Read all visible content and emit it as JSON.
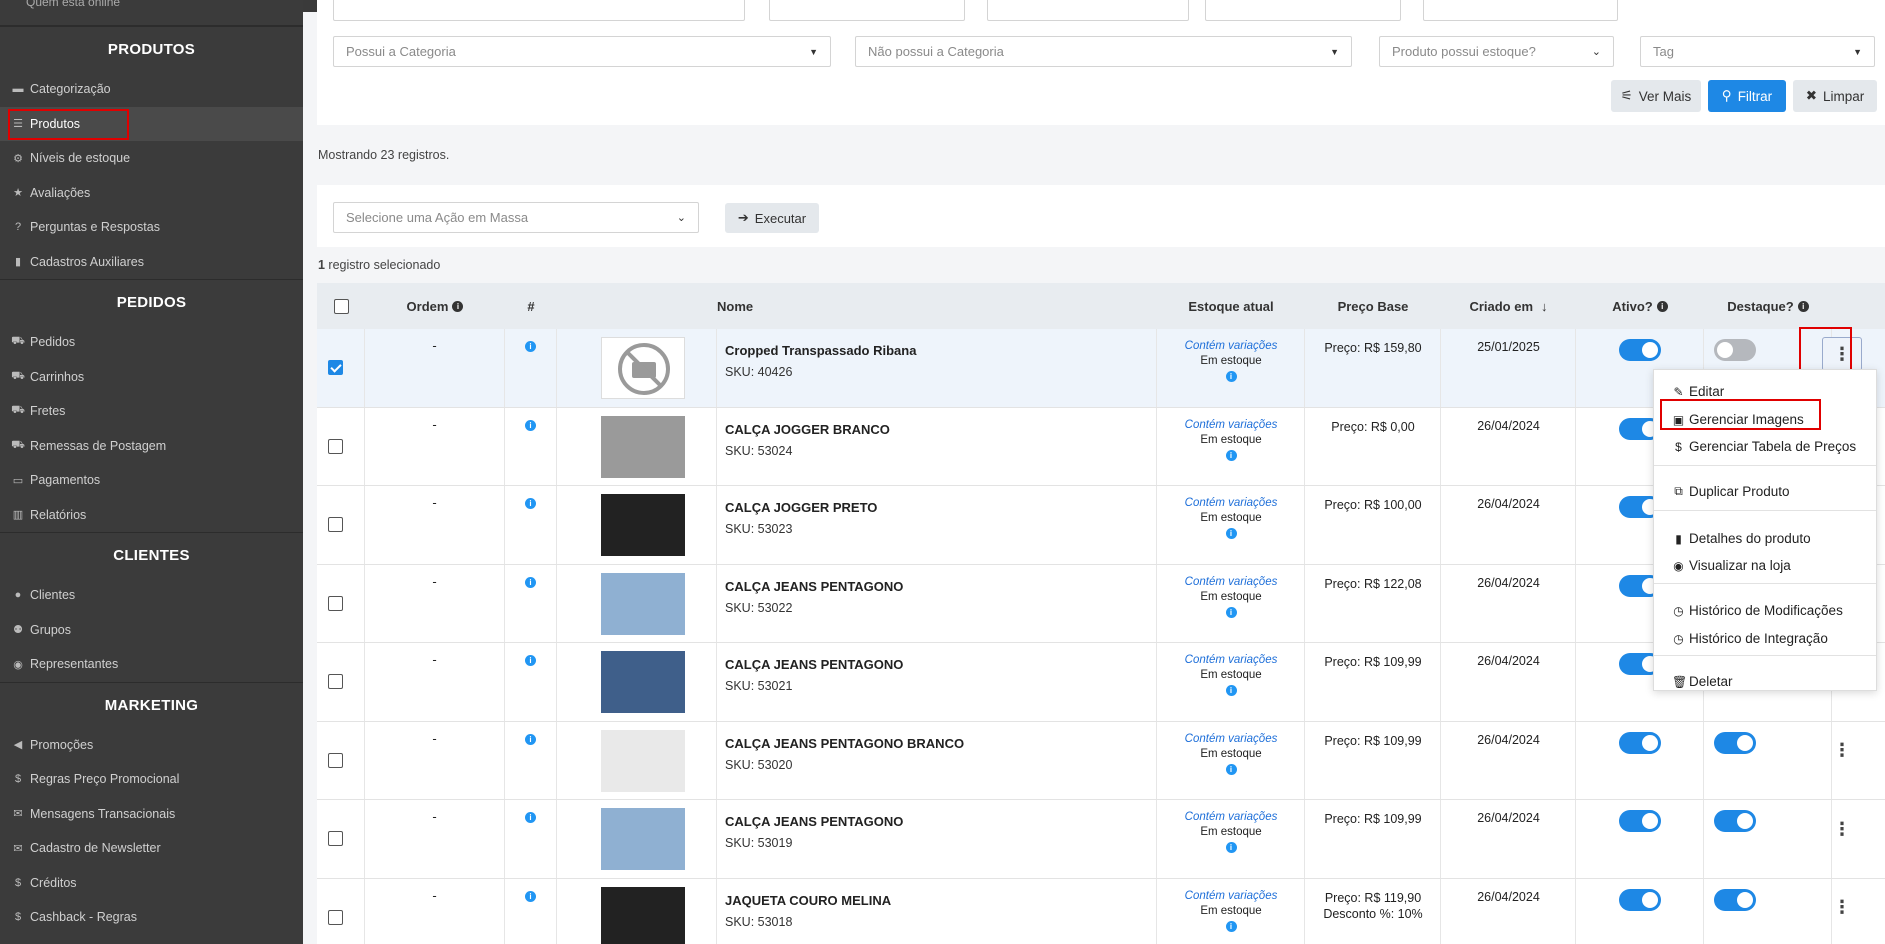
{
  "sidebar": {
    "top_partial": "Quem está online",
    "sections": [
      {
        "title": "PRODUTOS",
        "items": [
          {
            "label": "Categorização",
            "icon": "folder-icon"
          },
          {
            "label": "Produtos",
            "icon": "list-icon",
            "active": true
          },
          {
            "label": "Níveis de estoque",
            "icon": "boxes-icon"
          },
          {
            "label": "Avaliações",
            "icon": "star-icon"
          },
          {
            "label": "Perguntas e Respostas",
            "icon": "question-icon"
          },
          {
            "label": "Cadastros Auxiliares",
            "icon": "file-icon"
          }
        ]
      },
      {
        "title": "PEDIDOS",
        "items": [
          {
            "label": "Pedidos",
            "icon": "cart-icon"
          },
          {
            "label": "Carrinhos",
            "icon": "cart-icon"
          },
          {
            "label": "Fretes",
            "icon": "truck-icon"
          },
          {
            "label": "Remessas de Postagem",
            "icon": "truck-icon"
          },
          {
            "label": "Pagamentos",
            "icon": "card-icon"
          },
          {
            "label": "Relatórios",
            "icon": "chart-icon"
          }
        ]
      },
      {
        "title": "CLIENTES",
        "items": [
          {
            "label": "Clientes",
            "icon": "user-icon"
          },
          {
            "label": "Grupos",
            "icon": "users-icon"
          },
          {
            "label": "Representantes",
            "icon": "user-circle-icon"
          }
        ]
      },
      {
        "title": "MARKETING",
        "items": [
          {
            "label": "Promoções",
            "icon": "megaphone-icon"
          },
          {
            "label": "Regras Preço Promocional",
            "icon": "dollar-icon"
          },
          {
            "label": "Mensagens Transacionais",
            "icon": "envelope-icon"
          },
          {
            "label": "Cadastro de Newsletter",
            "icon": "envelope-icon"
          },
          {
            "label": "Créditos",
            "icon": "dollar-icon"
          },
          {
            "label": "Cashback - Regras",
            "icon": "dollar-icon"
          }
        ]
      }
    ]
  },
  "filters": {
    "possui_categoria": "Possui a Categoria",
    "nao_possui_categoria": "Não possui a Categoria",
    "estoque": "Produto possui estoque?",
    "tag": "Tag",
    "ver_mais": "Ver Mais",
    "filtrar": "Filtrar",
    "limpar": "Limpar"
  },
  "info": {
    "showing": "Mostrando 23 registros.",
    "selected_count": "1",
    "selected_text": " registro selecionado"
  },
  "mass_action": {
    "placeholder": "Selecione uma Ação em Massa",
    "execute": "Executar"
  },
  "table": {
    "headers": {
      "ordem": "Ordem",
      "hash": "#",
      "nome": "Nome",
      "estoque": "Estoque atual",
      "preco": "Preço Base",
      "criado": "Criado em",
      "ativo": "Ativo?",
      "destaque": "Destaque?"
    },
    "rows": [
      {
        "ordem": "-",
        "name": "Cropped Transpassado Ribana",
        "sku": "SKU: 40426",
        "variations": "Contém variações",
        "stock": "Em estoque",
        "price": "Preço: R$ 159,80",
        "discount": "",
        "date": "25/01/2025",
        "active": true,
        "featured": false,
        "checked": true,
        "thumb": "no-photo"
      },
      {
        "ordem": "-",
        "name": "CALÇA JOGGER BRANCO",
        "sku": "SKU: 53024",
        "variations": "Contém variações",
        "stock": "Em estoque",
        "price": "Preço: R$ 0,00",
        "discount": "",
        "date": "26/04/2024",
        "active": true,
        "featured": true,
        "checked": false,
        "thumb": "gray"
      },
      {
        "ordem": "-",
        "name": "CALÇA JOGGER PRETO",
        "sku": "SKU: 53023",
        "variations": "Contém variações",
        "stock": "Em estoque",
        "price": "Preço: R$ 100,00",
        "discount": "",
        "date": "26/04/2024",
        "active": true,
        "featured": true,
        "checked": false,
        "thumb": "black"
      },
      {
        "ordem": "-",
        "name": "CALÇA JEANS PENTAGONO",
        "sku": "SKU: 53022",
        "variations": "Contém variações",
        "stock": "Em estoque",
        "price": "Preço: R$ 122,08",
        "discount": "",
        "date": "26/04/2024",
        "active": true,
        "featured": true,
        "checked": false,
        "thumb": "lightblue"
      },
      {
        "ordem": "-",
        "name": "CALÇA JEANS PENTAGONO",
        "sku": "SKU: 53021",
        "variations": "Contém variações",
        "stock": "Em estoque",
        "price": "Preço: R$ 109,99",
        "discount": "",
        "date": "26/04/2024",
        "active": true,
        "featured": true,
        "checked": false,
        "thumb": "blue"
      },
      {
        "ordem": "-",
        "name": "CALÇA JEANS PENTAGONO BRANCO",
        "sku": "SKU: 53020",
        "variations": "Contém variações",
        "stock": "Em estoque",
        "price": "Preço: R$ 109,99",
        "discount": "",
        "date": "26/04/2024",
        "active": true,
        "featured": true,
        "checked": false,
        "thumb": "white"
      },
      {
        "ordem": "-",
        "name": "CALÇA JEANS PENTAGONO",
        "sku": "SKU: 53019",
        "variations": "Contém variações",
        "stock": "Em estoque",
        "price": "Preço: R$ 109,99",
        "discount": "",
        "date": "26/04/2024",
        "active": true,
        "featured": true,
        "checked": false,
        "thumb": "lightblue"
      },
      {
        "ordem": "-",
        "name": "JAQUETA COURO MELINA",
        "sku": "SKU: 53018",
        "variations": "Contém variações",
        "stock": "Em estoque",
        "price": "Preço: R$ 119,90",
        "discount": "Desconto %: 10%",
        "date": "26/04/2024",
        "active": true,
        "featured": true,
        "checked": false,
        "thumb": "black"
      }
    ]
  },
  "menu": {
    "items": [
      {
        "label": "Editar",
        "icon": "pencil-icon"
      },
      {
        "label": "Gerenciar Imagens",
        "icon": "image-icon"
      },
      {
        "label": "Gerenciar Tabela de Preços",
        "icon": "dollar-icon"
      },
      {
        "label": "Duplicar Produto",
        "icon": "copy-icon"
      },
      {
        "label": "Detalhes do produto",
        "icon": "book-icon"
      },
      {
        "label": "Visualizar na loja",
        "icon": "eye-icon"
      },
      {
        "label": "Histórico de Modificações",
        "icon": "clock-icon"
      },
      {
        "label": "Histórico de Integração",
        "icon": "clock-icon"
      },
      {
        "label": "Deletar",
        "icon": "trash-icon"
      }
    ]
  },
  "colors": {
    "accent": "#1e88e5",
    "sidebar": "#3b3b3b",
    "highlight": "#e00000"
  }
}
